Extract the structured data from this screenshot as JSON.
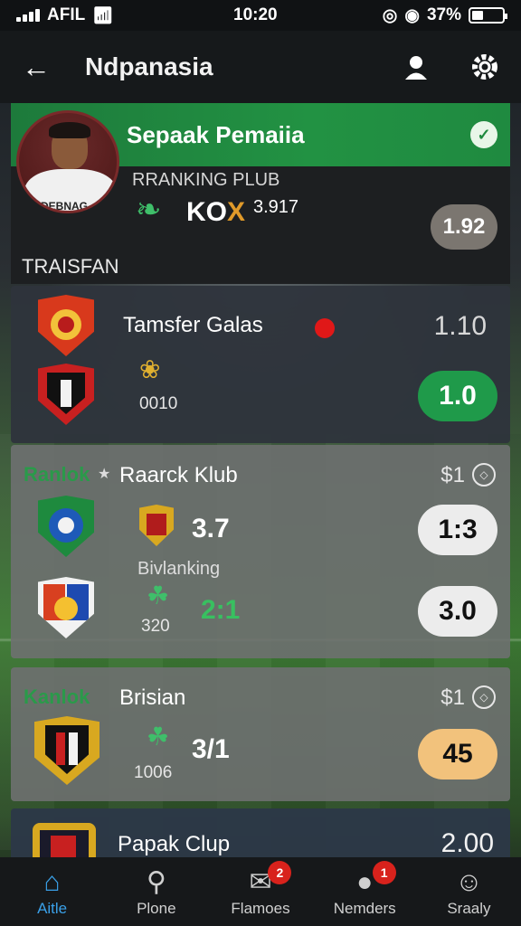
{
  "status_bar": {
    "carrier": "AFIL",
    "time": "10:20",
    "battery": "37%",
    "battery_level": 0.37
  },
  "app_bar": {
    "title": "Ndpanasia"
  },
  "hero": {
    "title": "Sepaak Pemaiia",
    "ranking_label": "RRANKING PLUB",
    "code": "KO",
    "code_accent": "X",
    "number": "3.917",
    "pill": "1.92",
    "jersey_text": "DEBNAG",
    "section": "TRAISFAN"
  },
  "cards": [
    {
      "title": "Tamsfer Galas",
      "value_top": "1.10",
      "sub": "0010",
      "pill": "1.0",
      "pill_color": "#1f9a4a"
    },
    {
      "tag": "Ranlok",
      "title": "Raarck Klub",
      "meta": "$1",
      "score1": "3.7",
      "sub_label": "Bivlanking",
      "score2": "2:1",
      "sub2": "320",
      "pill1": "1:3",
      "pill2": "3.0"
    },
    {
      "tag": "Kanlok",
      "title": "Brisian",
      "meta": "$1",
      "score": "3/1",
      "sub": "1006",
      "pill": "45",
      "pill_color": "#f2c27c"
    },
    {
      "title": "Papak Clup",
      "value": "2.00"
    }
  ],
  "bottom_nav": [
    {
      "label": "Aitle",
      "icon": "home-icon",
      "badge": ""
    },
    {
      "label": "Plone",
      "icon": "search-icon",
      "badge": ""
    },
    {
      "label": "Flamoes",
      "icon": "inbox-icon",
      "badge": "2"
    },
    {
      "label": "Nemders",
      "icon": "ball-icon",
      "badge": "1"
    },
    {
      "label": "Sraaly",
      "icon": "profile-icon",
      "badge": ""
    }
  ],
  "colors": {
    "accent_green": "#229243",
    "active_blue": "#3aa0e8",
    "badge_red": "#d8221c"
  }
}
